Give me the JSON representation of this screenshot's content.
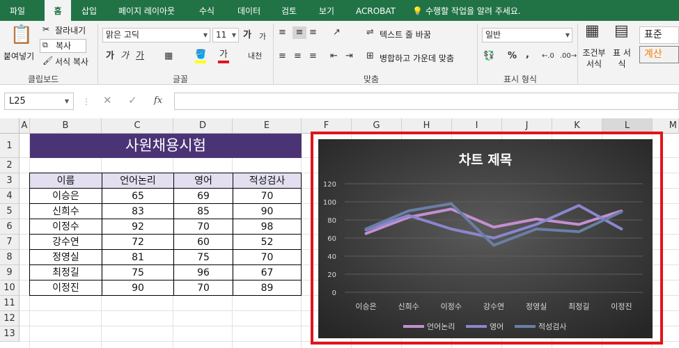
{
  "tabs": [
    "파일",
    "홈",
    "삽입",
    "페이지 레이아웃",
    "수식",
    "데이터",
    "검토",
    "보기",
    "ACROBAT"
  ],
  "tell_me": "수행할 작업을 알려 주세요.",
  "clipboard": {
    "paste": "붙여넣기",
    "cut": "잘라내기",
    "copy": "복사",
    "format_painter": "서식 복사",
    "label": "클립보드"
  },
  "font": {
    "name": "맑은 고딕",
    "size": "11",
    "label": "글꼴",
    "grow": "가",
    "shrink": "가",
    "bold": "가",
    "italic": "가",
    "underline": "가",
    "phonetic": "내천"
  },
  "alignment": {
    "wrap": "텍스트 줄 바꿈",
    "merge": "병합하고 가운데 맞춤",
    "label": "맞춤"
  },
  "number": {
    "format": "일반",
    "label": "표시 형식",
    "percent": "%",
    "comma": ","
  },
  "styles": {
    "conditional": "조건부 서식",
    "table": "표 서식",
    "normal": "표준",
    "calc": "계산"
  },
  "name_box": "L25",
  "fx": "fx",
  "columns": [
    "A",
    "B",
    "C",
    "D",
    "E",
    "F",
    "G",
    "H",
    "I",
    "J",
    "K",
    "L",
    "M"
  ],
  "rows": [
    "1",
    "2",
    "3",
    "4",
    "5",
    "6",
    "7",
    "8",
    "9",
    "10",
    "11",
    "12",
    "13"
  ],
  "sheet": {
    "title": "사원채용시험",
    "headers": [
      "이름",
      "언어논리",
      "영어",
      "적성검사"
    ],
    "rows": [
      [
        "이승은",
        "65",
        "69",
        "70"
      ],
      [
        "신희수",
        "83",
        "85",
        "90"
      ],
      [
        "이정수",
        "92",
        "70",
        "98"
      ],
      [
        "강수연",
        "72",
        "60",
        "52"
      ],
      [
        "정영실",
        "81",
        "75",
        "70"
      ],
      [
        "최정길",
        "75",
        "96",
        "67"
      ],
      [
        "이정진",
        "90",
        "70",
        "89"
      ]
    ]
  },
  "chart_data": {
    "type": "line",
    "title": "차트 제목",
    "categories": [
      "이승은",
      "신희수",
      "이정수",
      "강수연",
      "정영실",
      "최정길",
      "이정진"
    ],
    "series": [
      {
        "name": "언어논리",
        "values": [
          65,
          83,
          92,
          72,
          81,
          75,
          90
        ],
        "color": "#c48fd0"
      },
      {
        "name": "영어",
        "values": [
          69,
          85,
          70,
          60,
          75,
          96,
          70
        ],
        "color": "#8a86cf"
      },
      {
        "name": "적성검사",
        "values": [
          70,
          90,
          98,
          52,
          70,
          67,
          89
        ],
        "color": "#6a7fa6"
      }
    ],
    "ylim": [
      0,
      120
    ],
    "yticks": [
      "0",
      "20",
      "40",
      "60",
      "80",
      "100",
      "120"
    ],
    "legend": "bottom",
    "grid": true,
    "background": "#3a3a3a"
  }
}
